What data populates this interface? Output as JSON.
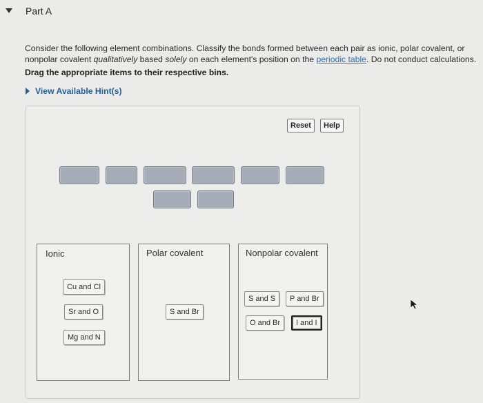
{
  "header": {
    "title": "Part A"
  },
  "question": {
    "text_1": "Consider the following element combinations. Classify the bonds formed between each pair as ionic, polar covalent, or nonpolar covalent ",
    "emph_1": "qualitatively",
    "text_2": " based ",
    "emph_2": "solely",
    "text_3": " on each element's position on the ",
    "link": "periodic table",
    "text_4": ". Do not conduct calculations."
  },
  "instruction": "Drag the appropriate items to their respective bins.",
  "hint": {
    "label": "View Available Hint(s)"
  },
  "toolbar": {
    "reset_label": "Reset",
    "help_label": "Help"
  },
  "bins": [
    {
      "label": "Ionic",
      "items": [
        "Cu and Cl",
        "Sr and O",
        "Mg and N"
      ]
    },
    {
      "label": "Polar covalent",
      "items": [
        "S and Br"
      ]
    },
    {
      "label": "Nonpolar covalent",
      "items": [
        "S and S",
        "P and Br",
        "O and Br",
        "I and I"
      ]
    }
  ],
  "colors": {
    "link": "#2c6fb5",
    "empty_slot": "#a6adb6",
    "background": "#ebebe9"
  }
}
